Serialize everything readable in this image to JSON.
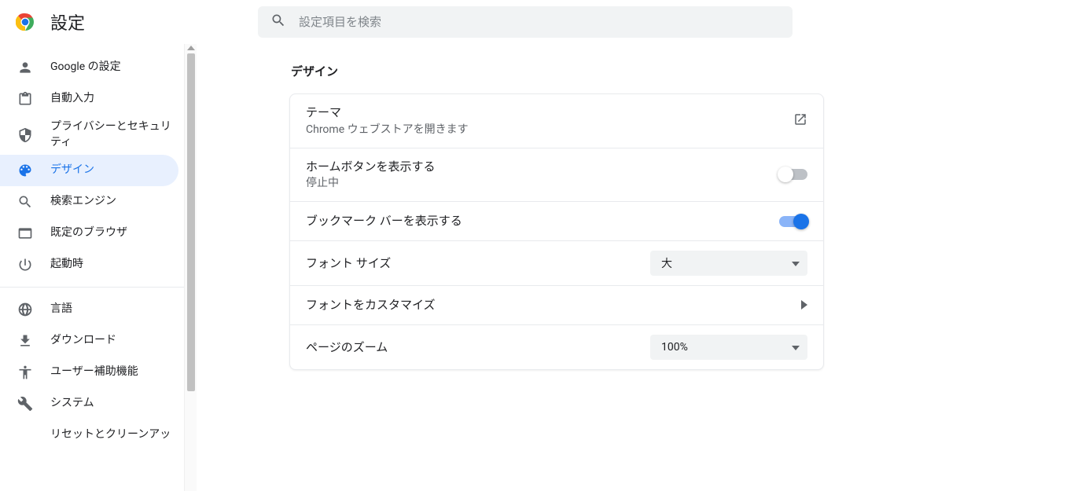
{
  "header": {
    "title": "設定"
  },
  "search": {
    "placeholder": "設定項目を検索"
  },
  "sidebar": {
    "items": [
      {
        "label": "Google の設定"
      },
      {
        "label": "自動入力"
      },
      {
        "label": "プライバシーとセキュリティ"
      },
      {
        "label": "デザイン"
      },
      {
        "label": "検索エンジン"
      },
      {
        "label": "既定のブラウザ"
      },
      {
        "label": "起動時"
      },
      {
        "label": "言語"
      },
      {
        "label": "ダウンロード"
      },
      {
        "label": "ユーザー補助機能"
      },
      {
        "label": "システム"
      },
      {
        "label": "リセットとクリーンアッ"
      }
    ]
  },
  "section": {
    "title": "デザイン"
  },
  "rows": {
    "theme": {
      "label": "テーマ",
      "sub": "Chrome ウェブストアを開きます"
    },
    "homeButton": {
      "label": "ホームボタンを表示する",
      "sub": "停止中"
    },
    "bookmarkBar": {
      "label": "ブックマーク バーを表示する"
    },
    "fontSize": {
      "label": "フォント サイズ",
      "value": "大"
    },
    "customizeFonts": {
      "label": "フォントをカスタマイズ"
    },
    "pageZoom": {
      "label": "ページのズーム",
      "value": "100%"
    }
  }
}
